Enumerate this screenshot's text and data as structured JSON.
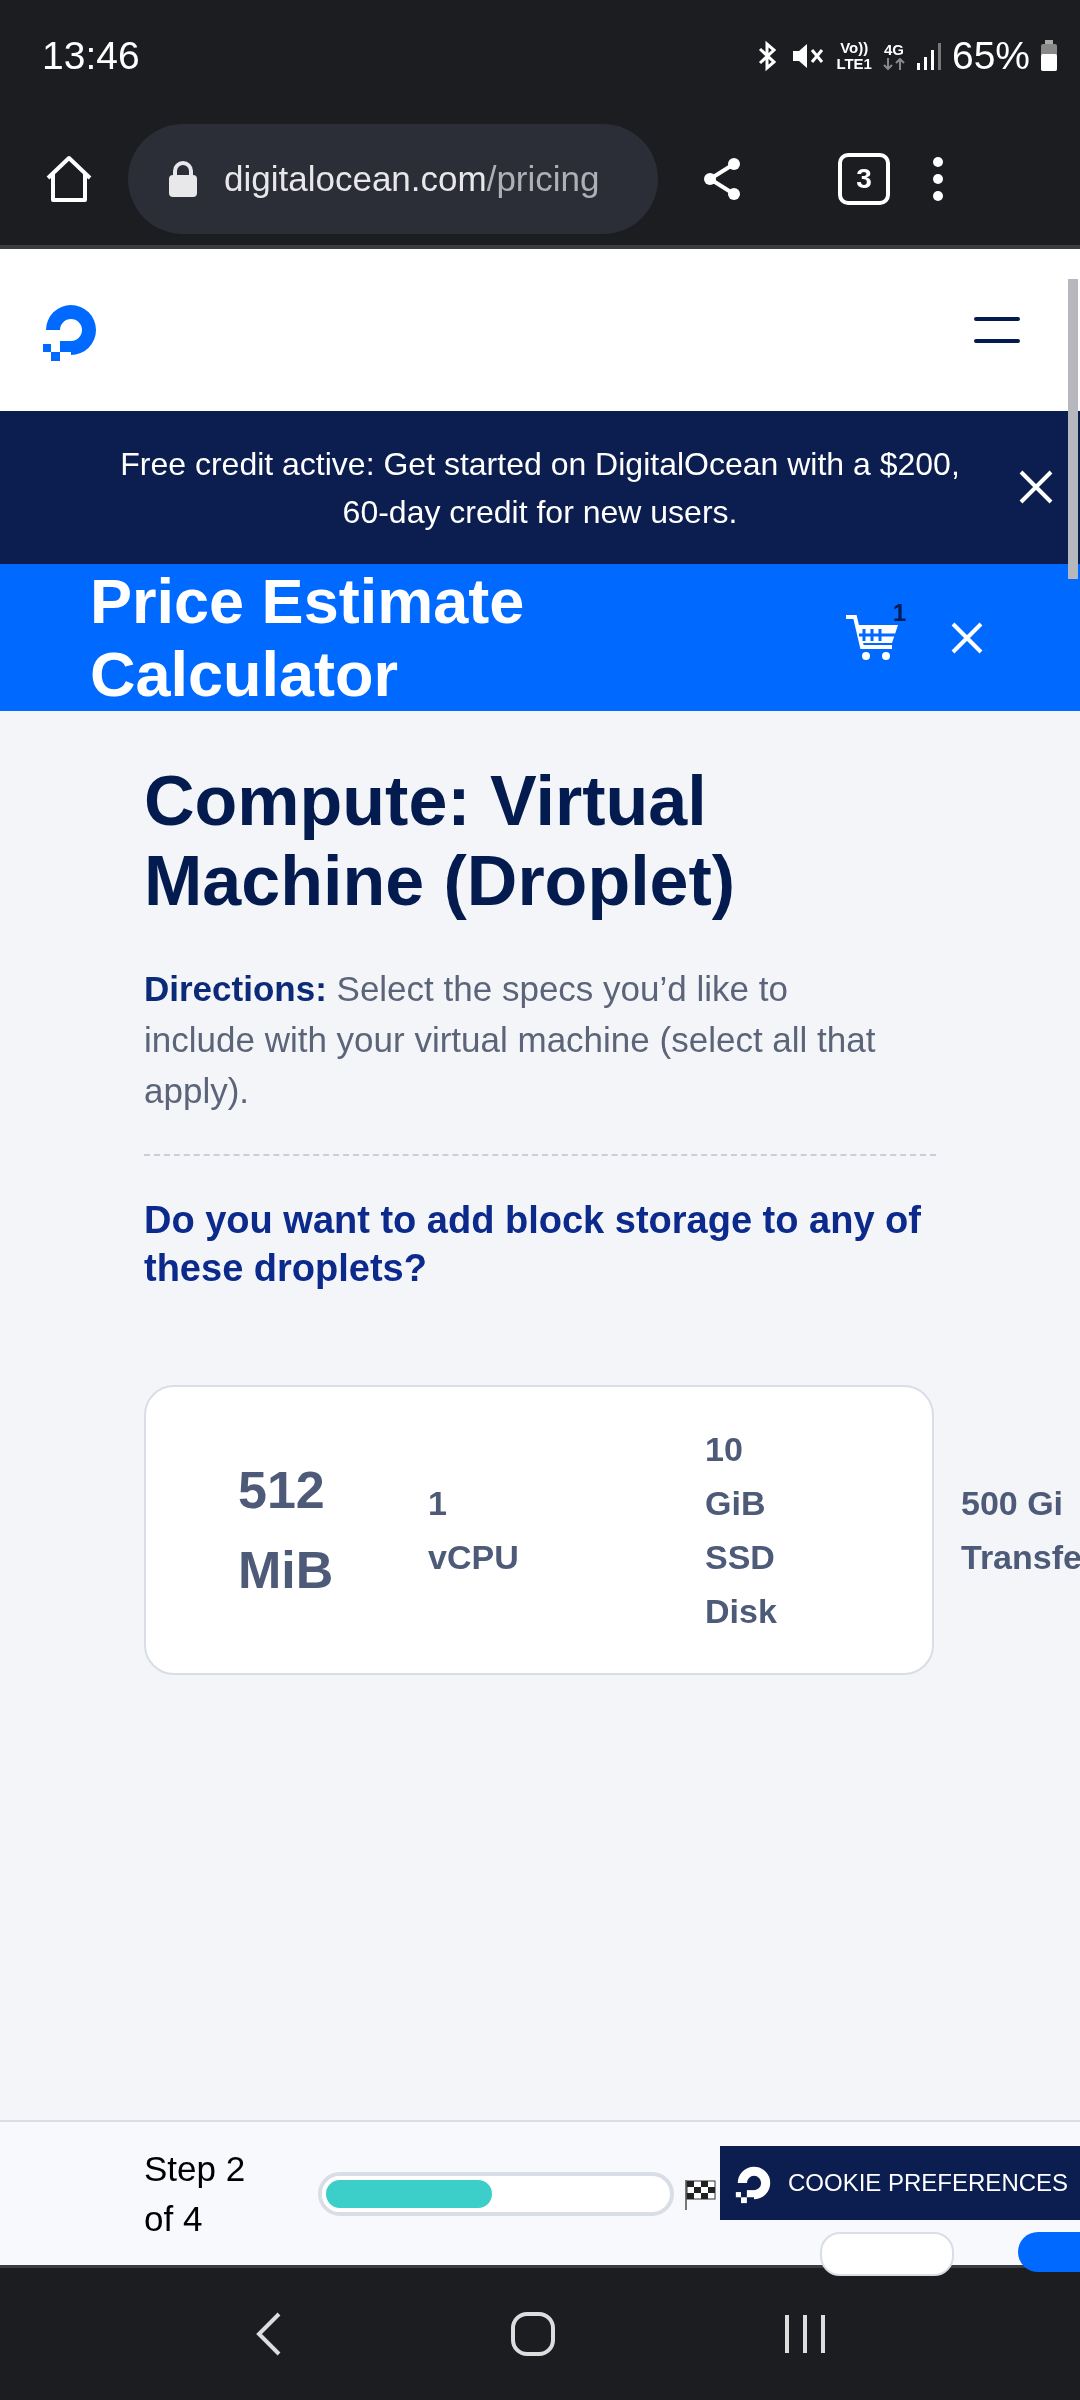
{
  "status_bar": {
    "time": "13:46",
    "volte_top": "Vo))",
    "volte_bottom": "LTE1",
    "network": "4G",
    "battery": "65%"
  },
  "browser": {
    "url_domain": "digitalocean.com",
    "url_path": "/pricing",
    "tab_count": "3"
  },
  "banner": {
    "text": "Free credit active: Get started on DigitalOcean with a $200, 60-day credit for new users."
  },
  "calculator_bar": {
    "title": "Price Estimate Calculator",
    "cart_count": "1"
  },
  "section": {
    "heading": "Compute: Virtual Machine (Droplet)",
    "directions": "**Directions:** Select the specs you’d like to include with your virtual machine (select all that apply).",
    "question": "Do you want to add block storage to any of these droplets?"
  },
  "droplet_card": {
    "memory": [
      "512",
      "MiB"
    ],
    "specs": [
      {
        "lines": [
          "1",
          "vCPU"
        ]
      },
      {
        "lines": [
          "10",
          "GiB",
          "SSD",
          "Disk"
        ]
      },
      {
        "lines": [
          "500 Gi",
          "Transfe"
        ]
      }
    ]
  },
  "footer": {
    "step": "Step 2 of 4",
    "progress": {
      "level": 0.5
    },
    "cookie_button": "COOKIE PREFERENCES"
  }
}
